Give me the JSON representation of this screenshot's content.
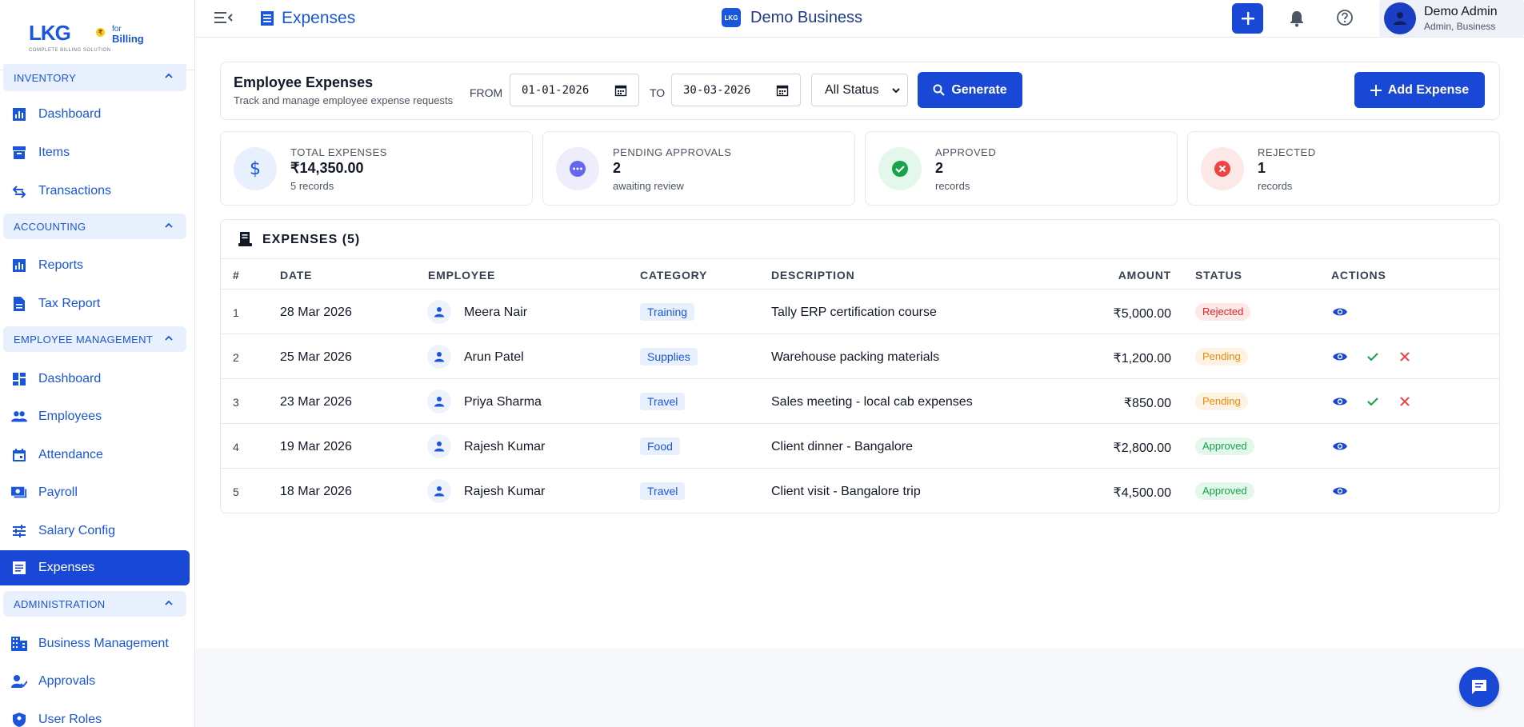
{
  "sidebar": {
    "logo": {
      "main": "LKG",
      "for": "for",
      "billing": "Billing",
      "tagline": "COMPLETE BILLING SOLUTION"
    },
    "sections": {
      "inventory": "INVENTORY",
      "accounting": "ACCOUNTING",
      "employee_management": "EMPLOYEE MANAGEMENT",
      "administration": "ADMINISTRATION"
    },
    "items": {
      "inv_dashboard": "Dashboard",
      "items": "Items",
      "transactions": "Transactions",
      "reports": "Reports",
      "tax_report": "Tax Report",
      "emp_dashboard": "Dashboard",
      "employees": "Employees",
      "attendance": "Attendance",
      "payroll": "Payroll",
      "salary_config": "Salary Config",
      "expenses": "Expenses",
      "business_management": "Business Management",
      "approvals": "Approvals",
      "user_roles": "User Roles"
    },
    "active": "expenses"
  },
  "topbar": {
    "page_title": "Expenses",
    "business_logo_text": "LKG",
    "business_name": "Demo Business",
    "user_name": "Demo Admin",
    "user_role": "Admin, Business"
  },
  "filter": {
    "title": "Employee Expenses",
    "subtitle": "Track and manage employee expense requests",
    "from_label": "FROM",
    "from_value": "01-01-2026",
    "to_label": "TO",
    "to_value": "30-03-2026",
    "status_value": "All Status",
    "generate_label": "Generate",
    "add_label": "Add Expense"
  },
  "stats": {
    "total": {
      "label": "TOTAL EXPENSES",
      "value": "₹14,350.00",
      "note": "5 records",
      "color": "#1a56db"
    },
    "pending": {
      "label": "PENDING APPROVALS",
      "value": "2",
      "note": "awaiting review",
      "color": "#6366f1"
    },
    "approved": {
      "label": "APPROVED",
      "value": "2",
      "note": "records",
      "color": "#16a34a"
    },
    "rejected": {
      "label": "REJECTED",
      "value": "1",
      "note": "records",
      "color": "#ef4444"
    }
  },
  "table": {
    "title": "EXPENSES (5)",
    "columns": {
      "num": "#",
      "date": "DATE",
      "employee": "EMPLOYEE",
      "category": "CATEGORY",
      "description": "DESCRIPTION",
      "amount": "AMOUNT",
      "status": "STATUS",
      "actions": "ACTIONS"
    },
    "rows": [
      {
        "num": "1",
        "date": "28 Mar 2026",
        "employee": "Meera Nair",
        "category": "Training",
        "description": "Tally ERP certification course",
        "amount": "₹5,000.00",
        "status": "Rejected"
      },
      {
        "num": "2",
        "date": "25 Mar 2026",
        "employee": "Arun Patel",
        "category": "Supplies",
        "description": "Warehouse packing materials",
        "amount": "₹1,200.00",
        "status": "Pending"
      },
      {
        "num": "3",
        "date": "23 Mar 2026",
        "employee": "Priya Sharma",
        "category": "Travel",
        "description": "Sales meeting - local cab expenses",
        "amount": "₹850.00",
        "status": "Pending"
      },
      {
        "num": "4",
        "date": "19 Mar 2026",
        "employee": "Rajesh Kumar",
        "category": "Food",
        "description": "Client dinner - Bangalore",
        "amount": "₹2,800.00",
        "status": "Approved"
      },
      {
        "num": "5",
        "date": "18 Mar 2026",
        "employee": "Rajesh Kumar",
        "category": "Travel",
        "description": "Client visit - Bangalore trip",
        "amount": "₹4,500.00",
        "status": "Approved"
      }
    ]
  },
  "colors": {
    "accent": "#1a48d6",
    "brand": "#1a56db"
  }
}
